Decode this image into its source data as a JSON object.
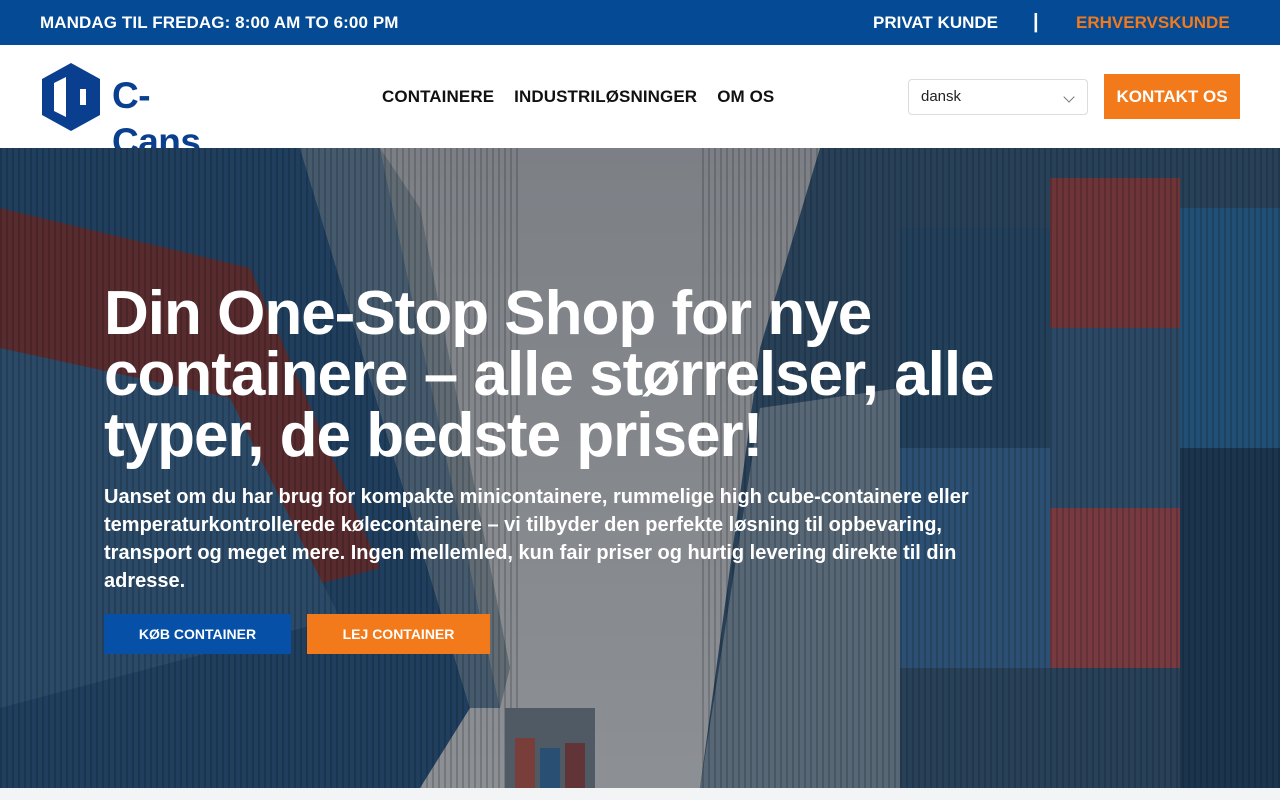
{
  "topbar": {
    "hours": "MANDAG TIL FREDAG: 8:00 AM TO 6:00 PM",
    "privat_label": "PRIVAT KUNDE",
    "separator": "|",
    "erhverv_label": "ERHVERVSKUNDE"
  },
  "header": {
    "logo_text": "C-Cans",
    "nav": [
      {
        "label": "CONTAINERE"
      },
      {
        "label": "INDUSTRILØSNINGER"
      },
      {
        "label": "OM OS"
      }
    ],
    "language_selected": "dansk",
    "contact_label": "KONTAKT OS"
  },
  "hero": {
    "title": "Din One-Stop Shop for nye containere – alle størrelser, alle typer, de bedste priser!",
    "lead": "Uanset om du har brug for kompakte minicontainere, rummelige high cube-containere eller temperaturkontrollerede kølecontainere – vi tilbyder den perfekte løsning til opbevaring, transport og meget mere. Ingen mellemled, kun fair priser og hurtig levering direkte til din adresse.",
    "buy_label": "KØB CONTAINER",
    "rent_label": "LEJ CONTAINER"
  },
  "colors": {
    "brand_blue": "#044a95",
    "accent_orange": "#f27a1a",
    "button_blue": "#0650a8"
  }
}
